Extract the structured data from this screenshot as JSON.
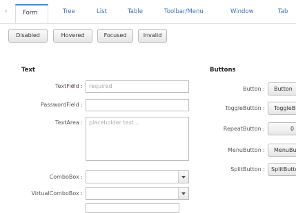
{
  "tabs": {
    "scroll_left_glyph": "‹",
    "items": [
      "Form",
      "Tree",
      "List",
      "Table",
      "Toolbar/Menu",
      "Window",
      "Tab"
    ],
    "active": "Form"
  },
  "state_buttons": [
    "Disabled",
    "Hovered",
    "Focused",
    "Invalid"
  ],
  "text_section": {
    "title": "Text",
    "textfield_label": "TextField :",
    "required_mark": "*",
    "textfield_placeholder": "required",
    "passwordfield_label": "PasswordField :",
    "textarea_label": "TextArea :",
    "textarea_placeholder": "placeholder test...",
    "combobox_label": "ComboBox :",
    "virtualcombobox_label": "VirtualComboBox :"
  },
  "buttons_section": {
    "title": "Buttons",
    "rows": [
      {
        "label": "Button :",
        "button": "Button"
      },
      {
        "label": "ToggleButton :",
        "button": "ToggleButton"
      },
      {
        "label": "RepeatButton :",
        "button": "0"
      },
      {
        "label": "MenuButton :",
        "button": "MenuButton"
      },
      {
        "label": "SplitButton :",
        "button": "SplitButton"
      }
    ]
  }
}
